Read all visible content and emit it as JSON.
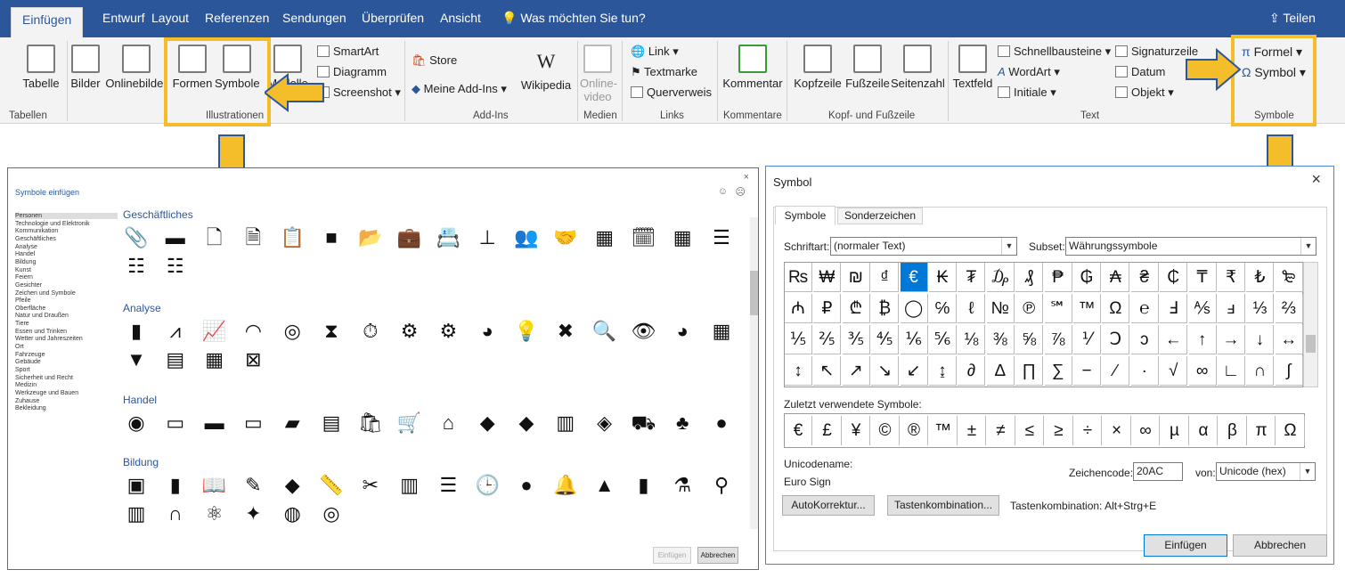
{
  "tabs": [
    "Einfügen",
    "Entwurf",
    "Layout",
    "Referenzen",
    "Sendungen",
    "Überprüfen",
    "Ansicht"
  ],
  "tell_me": "Was möchten Sie tun?",
  "share": "Teilen",
  "ribbon": {
    "tabelle": "Tabelle",
    "bilder": "Bilder",
    "onlinebilder": "Onlinebilder",
    "formen": "Formen",
    "symbole": "Symbole",
    "modelle": "Modelle",
    "smartart": "SmartArt",
    "diagramm": "Diagramm",
    "screenshot": "Screenshot",
    "store": "Store",
    "meine_addins": "Meine Add-Ins",
    "wikipedia": "Wikipedia",
    "onlinevideo": "Online-video",
    "link": "Link",
    "textmarke": "Textmarke",
    "querverweis": "Querverweis",
    "kommentar": "Kommentar",
    "kopfzeile": "Kopfzeile",
    "fusszeile": "Fußzeile",
    "seitenzahl": "Seitenzahl",
    "textfeld": "Textfeld",
    "schnellbausteine": "Schnellbausteine",
    "wordart": "WordArt",
    "initiale": "Initiale",
    "signaturzeile": "Signaturzeile",
    "datum": "Datum",
    "objekt": "Objekt",
    "formel": "Formel",
    "symbol": "Symbol",
    "groups": {
      "tabellen": "Tabellen",
      "illustrationen": "Illustrationen",
      "addins": "Add-Ins",
      "medien": "Medien",
      "links": "Links",
      "kommentare": "Kommentare",
      "kopf": "Kopf- und Fußzeile",
      "text": "Text",
      "symbole": "Symbole"
    }
  },
  "insert_icons": {
    "title": "Symbole einfügen",
    "sidebar": [
      "Personen",
      "Technologie und Elektronik",
      "Kommunikation",
      "Geschäftliches",
      "Analyse",
      "Handel",
      "Bildung",
      "Kunst",
      "Feiern",
      "Gesichter",
      "Zeichen und Symbole",
      "Pfeile",
      "Oberfläche",
      "Natur und Draußen",
      "Tiere",
      "Essen und Trinken",
      "Wetter und Jahreszeiten",
      "Ort",
      "Fahrzeuge",
      "Gebäude",
      "Sport",
      "Sicherheit und Recht",
      "Medizin",
      "Werkzeuge und Bauen",
      "Zuhause",
      "Bekleidung"
    ],
    "categories": [
      {
        "name": "Geschäftliches",
        "icons": [
          "📎",
          "▬",
          "🗋",
          "🗎",
          "📋",
          "■",
          "📂",
          "💼",
          "📇",
          "⊥",
          "👥",
          "🤝",
          "▦",
          "🗓",
          "▦",
          "☰",
          "☷",
          "☷"
        ]
      },
      {
        "name": "Analyse",
        "icons": [
          "▮",
          "⩘",
          "📈",
          "◠",
          "◎",
          "⧗",
          "⏱",
          "⚙",
          "⚙",
          "◕",
          "💡",
          "✖",
          "🔍",
          "👁",
          "◕",
          "▦",
          "▼",
          "▤",
          "▦",
          "⊠"
        ]
      },
      {
        "name": "Handel",
        "icons": [
          "◉",
          "▭",
          "▬",
          "▭",
          "▰",
          "▤",
          "🛍",
          "🛒",
          "⌂",
          "◆",
          "◆",
          "▥",
          "◈",
          "⛟",
          "♣",
          "●"
        ]
      },
      {
        "name": "Bildung",
        "icons": [
          "▣",
          "▮",
          "📖",
          "✎",
          "◆",
          "📏",
          "✂",
          "▥",
          "☰",
          "🕒",
          "●",
          "🔔",
          "▲",
          "▮",
          "⚗",
          "⚲",
          "▥",
          "∩",
          "⚛",
          "✦",
          "◍",
          "◎"
        ]
      }
    ],
    "insert": "Einfügen",
    "cancel": "Abbrechen"
  },
  "symbol_dialog": {
    "title": "Symbol",
    "tab_symbols": "Symbole",
    "tab_special": "Sonderzeichen",
    "font_label": "Schriftart:",
    "font_value": "(normaler Text)",
    "subset_label": "Subset:",
    "subset_value": "Währungssymbole",
    "rows": [
      [
        "₨",
        "₩",
        "₪",
        "₫",
        "€",
        "₭",
        "₮",
        "₯",
        "₰",
        "₱",
        "₲",
        "₳",
        "₴",
        "₵",
        "₸",
        "₹",
        "₺",
        "₻"
      ],
      [
        "₼",
        "₽",
        "₾",
        "₿",
        "◯",
        "℅",
        "ℓ",
        "№",
        "℗",
        "℠",
        "™",
        "Ω",
        "℮",
        "Ⅎ",
        "⅍",
        "ⅎ",
        "⅓",
        "⅔"
      ],
      [
        "⅕",
        "⅖",
        "⅗",
        "⅘",
        "⅙",
        "⅚",
        "⅛",
        "⅜",
        "⅝",
        "⅞",
        "⅟",
        "Ↄ",
        "ↄ",
        "←",
        "↑",
        "→",
        "↓",
        "↔"
      ],
      [
        "↕",
        "↖",
        "↗",
        "↘",
        "↙",
        "↨",
        "∂",
        "∆",
        "∏",
        "∑",
        "−",
        "∕",
        "∙",
        "√",
        "∞",
        "∟",
        "∩",
        "∫"
      ]
    ],
    "recent_label": "Zuletzt verwendete Symbole:",
    "recent": [
      "€",
      "£",
      "¥",
      "©",
      "®",
      "™",
      "±",
      "≠",
      "≤",
      "≥",
      "÷",
      "×",
      "∞",
      "µ",
      "α",
      "β",
      "π",
      "Ω"
    ],
    "unicode_name_label": "Unicodename:",
    "unicode_name": "Euro Sign",
    "code_label": "Zeichencode:",
    "code_value": "20AC",
    "from_label": "von:",
    "from_value": "Unicode (hex)",
    "autokorrektur": "AutoKorrektur...",
    "tastenkombination": "Tastenkombination...",
    "shortcut_text": "Tastenkombination: Alt+Strg+E",
    "insert": "Einfügen",
    "cancel": "Abbrechen"
  },
  "colors": {
    "accent": "#2b579a",
    "highlight": "#f4bd2a",
    "selected": "#0078d7"
  }
}
